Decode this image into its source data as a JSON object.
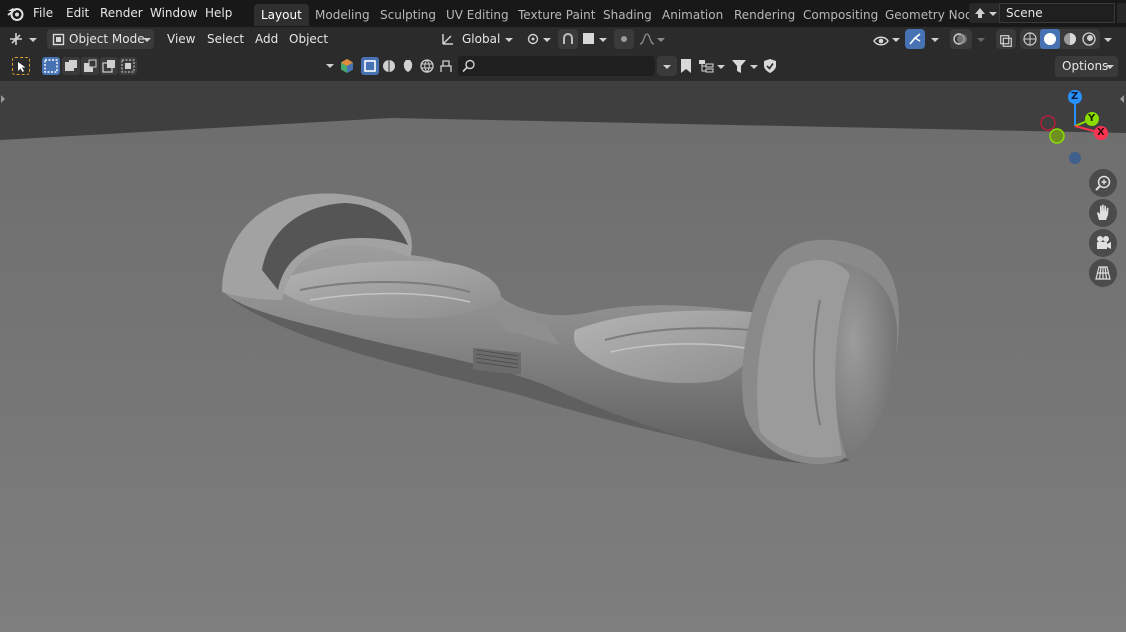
{
  "menus": [
    "File",
    "Edit",
    "Render",
    "Window",
    "Help"
  ],
  "workspaces": [
    "Layout",
    "Modeling",
    "Sculpting",
    "UV Editing",
    "Texture Paint",
    "Shading",
    "Animation",
    "Rendering",
    "Compositing",
    "Geometry Nod"
  ],
  "active_workspace": "Layout",
  "scene": "Scene",
  "viewport_header": {
    "mode": "Object Mode",
    "menus": [
      "View",
      "Select",
      "Add",
      "Object"
    ],
    "orientation": "Global"
  },
  "tool_settings": {
    "options_label": "Options",
    "filter_placeholder": ""
  },
  "gizmo": {
    "z": "Z",
    "y": "Y",
    "x": "X"
  },
  "colors": {
    "accent": "#4772b3",
    "axis_x": "#ff3352",
    "axis_y": "#8bdc00",
    "axis_z": "#2890ff"
  }
}
